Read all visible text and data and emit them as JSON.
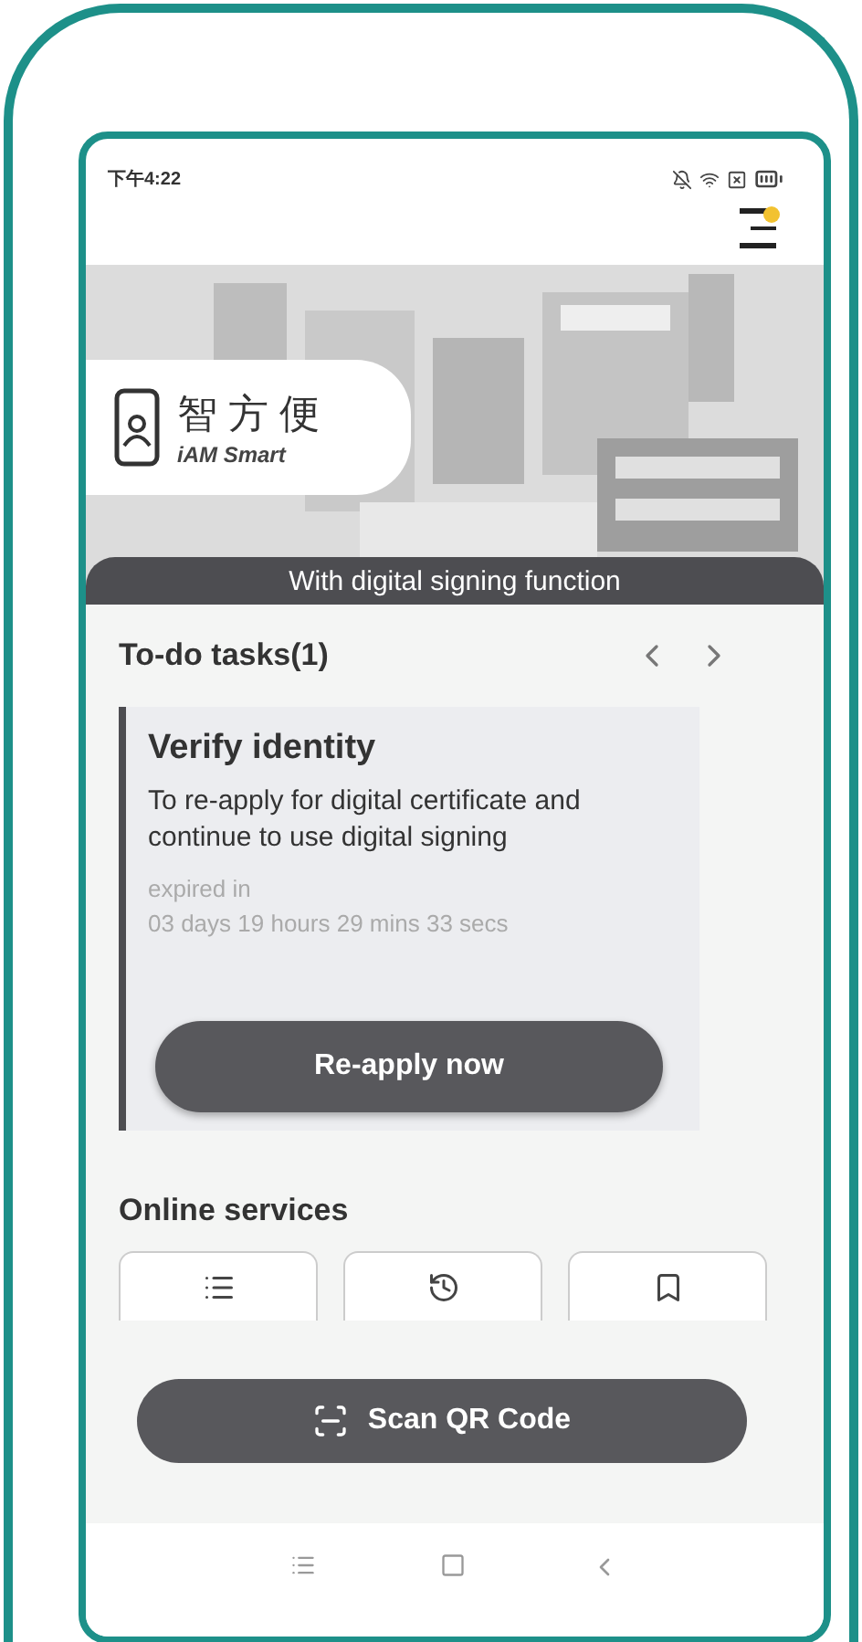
{
  "status_bar": {
    "time": "下午4:22"
  },
  "header": {
    "notification_dot": true
  },
  "banner": {
    "logo_chinese": "智方便",
    "logo_english": "iAM Smart",
    "caption": "With digital signing function"
  },
  "todo": {
    "title": "To-do tasks(1)",
    "tasks": [
      {
        "title": "Verify identity",
        "description": "To re-apply for digital certificate and continue to use digital signing",
        "expiry_label": "expired in",
        "countdown": "03 days 19 hours 29 mins 33 secs",
        "action": "Re-apply now"
      }
    ]
  },
  "online_services": {
    "title": "Online services",
    "tiles": [
      {
        "kind": "list"
      },
      {
        "kind": "history"
      },
      {
        "kind": "bookmark"
      }
    ]
  },
  "scan_button": "Scan QR Code"
}
